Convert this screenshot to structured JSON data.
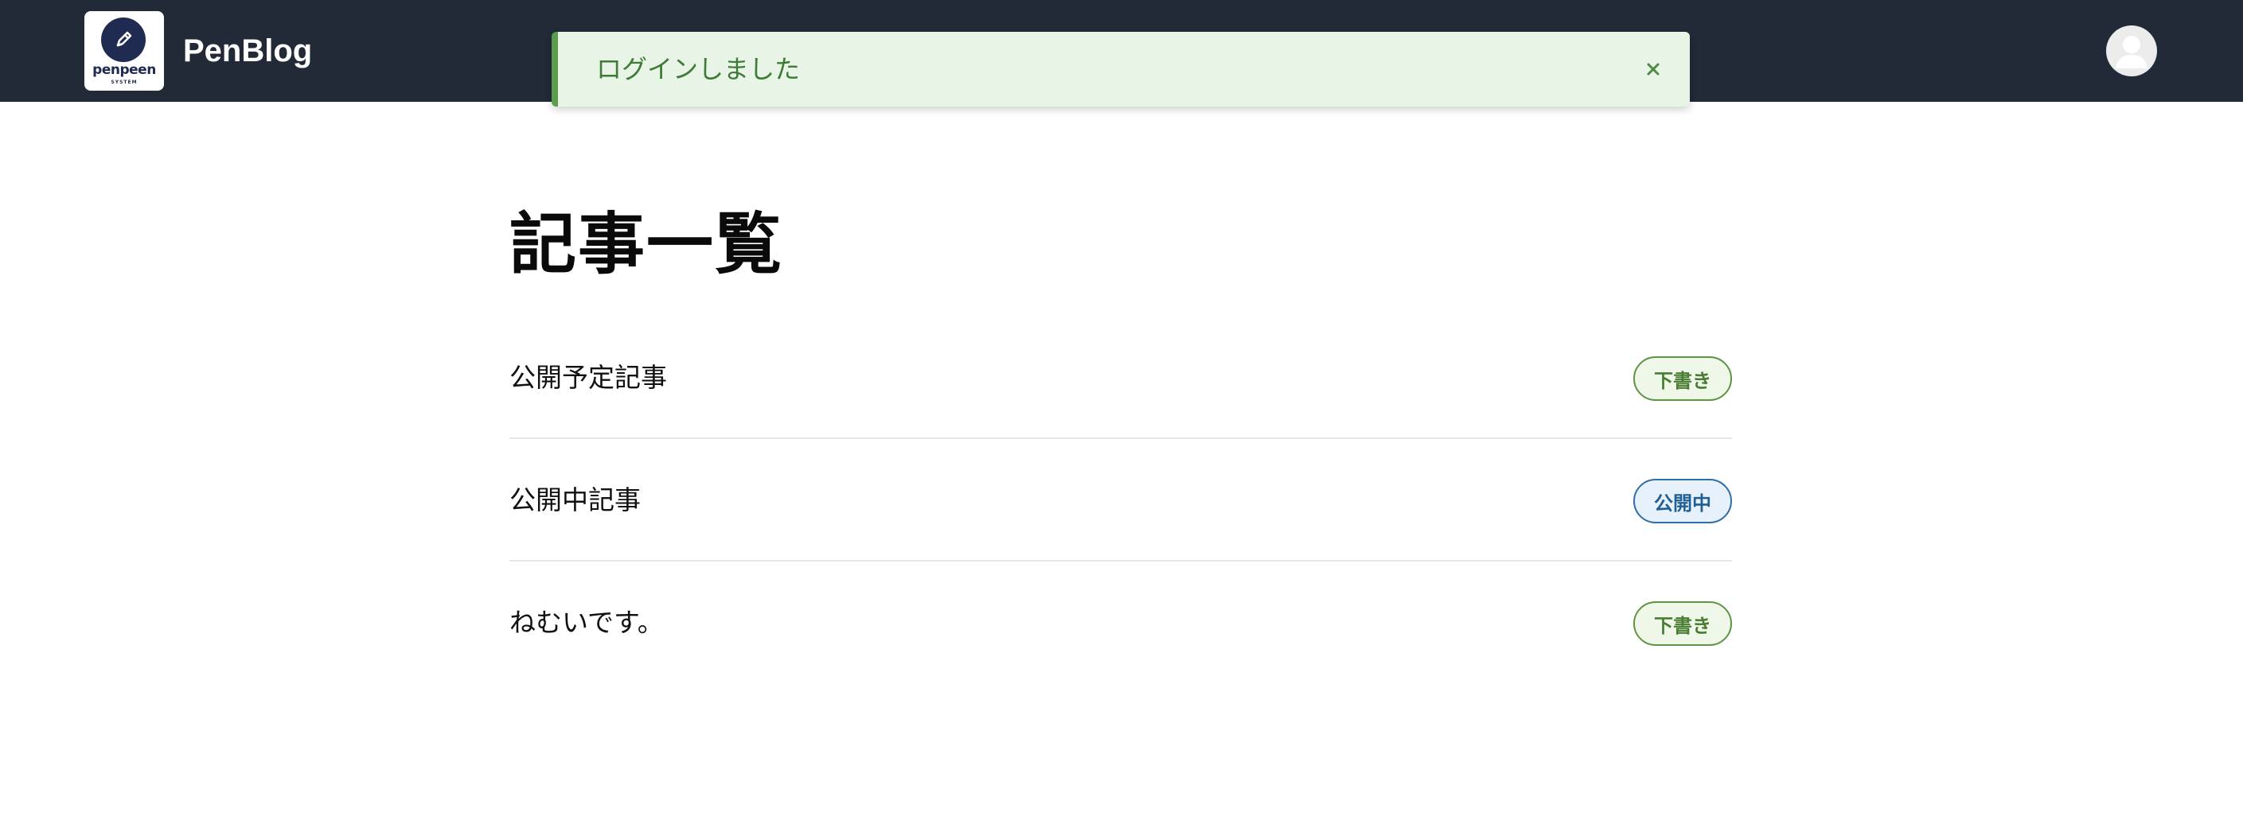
{
  "header": {
    "logo_text": "penpeen",
    "logo_subtext": "SYSTEM",
    "brand": "PenBlog"
  },
  "toast": {
    "message": "ログインしました",
    "close_glyph": "×"
  },
  "main": {
    "title": "記事一覧",
    "articles": [
      {
        "title": "公開予定記事",
        "status": "下書き",
        "status_type": "draft"
      },
      {
        "title": "公開中記事",
        "status": "公開中",
        "status_type": "published"
      },
      {
        "title": "ねむいです。",
        "status": "下書き",
        "status_type": "draft"
      }
    ]
  },
  "colors": {
    "header_bg": "#222a38",
    "toast_bg": "#e7f4e6",
    "toast_accent": "#5d9b4f",
    "draft_badge": "#5f9346",
    "published_badge": "#2f6fa5"
  },
  "icons": {
    "logo": "pen-icon",
    "user": "user-avatar-icon",
    "close": "close-icon"
  }
}
